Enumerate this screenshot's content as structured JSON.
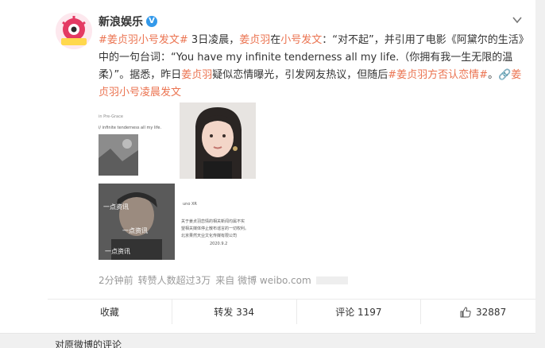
{
  "post": {
    "author": "新浪娱乐",
    "verified_mark": "V",
    "segments": [
      {
        "text": "#姜贞羽小号发文#",
        "style": "tag"
      },
      {
        "text": " 3日凌晨，",
        "style": "plain"
      },
      {
        "text": "姜贞羽",
        "style": "hl"
      },
      {
        "text": "在",
        "style": "plain"
      },
      {
        "text": "小号发文",
        "style": "hl"
      },
      {
        "text": "：“对不起”，并引用了电影《阿黛尔的生活》中的一句台词：“You have my infinite tenderness all my life.（你拥有我一生无限的温柔）”。据悉，昨日",
        "style": "plain"
      },
      {
        "text": "姜贞羽",
        "style": "hl"
      },
      {
        "text": "疑似恋情曝光，引发网友热议，但随后",
        "style": "plain"
      },
      {
        "text": "#姜贞羽方否认恋情#",
        "style": "tag"
      },
      {
        "text": "。",
        "style": "plain"
      },
      {
        "text": "姜贞羽小号凌晨发文",
        "style": "link"
      }
    ],
    "images": {
      "img1_caption": "i/ infinite tenderness all my life.",
      "img1_top": "in Pre-Grace",
      "img3_watermark": "一点资讯",
      "img4_date_label": "2020.9.2",
      "img4_line1": "关于姜贞羽恋情的相关新闻均属不实",
      "img4_line2": "望相关媒体停止散布谣言的一切权利。",
      "img4_line3": "北京果然天业文化传媒有限公司",
      "img4_small": "uno XR"
    },
    "meta": {
      "time": "2分钟前",
      "reposts_note": "转赞人数超过3万",
      "source": "来自 微博 weibo.com"
    }
  },
  "actions": {
    "favorite": "收藏",
    "repost": "转发 334",
    "comment": "评论 1197",
    "like": "32887"
  },
  "footer": {
    "label": "对原微博的评论"
  },
  "colors": {
    "accent": "#eb7350",
    "verified": "#3399ea"
  }
}
